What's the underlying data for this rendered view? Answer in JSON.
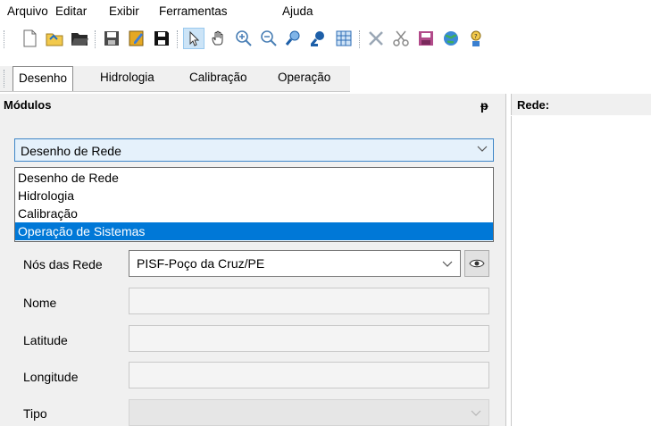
{
  "menu": {
    "items": [
      "Arquivo",
      "Editar",
      "Exibir",
      "Ferramentas",
      "Ajuda"
    ]
  },
  "toolbar": {
    "icons": [
      "new-file-icon",
      "open-icon",
      "open-folder-icon",
      "save-icon",
      "edit-icon",
      "save-as-icon",
      "pointer-icon",
      "pan-hand-icon",
      "zoom-in-icon",
      "zoom-out-icon",
      "zoom-extent-icon",
      "zoom-window-icon",
      "grid-icon",
      "tools-icon",
      "cut-icon",
      "export-icon",
      "globe-icon",
      "help-icon"
    ]
  },
  "tabs": {
    "items": [
      "Desenho",
      "Hidrologia",
      "Calibração",
      "Operação"
    ],
    "active": "Desenho"
  },
  "panel": {
    "title": "Módulos",
    "pin_glyph": "ᵽ"
  },
  "right": {
    "title": "Rede:"
  },
  "module_combo": {
    "value": "Desenho de Rede"
  },
  "dropdown": {
    "options": [
      "Desenho de Rede",
      "Hidrologia",
      "Calibração",
      "Operação de Sistemas"
    ],
    "highlighted": "Operação de Sistemas"
  },
  "form": {
    "nos_label": "Nós das Rede",
    "nos_value": "PISF-Poço da Cruz/PE",
    "nome_label": "Nome",
    "latitude_label": "Latitude",
    "longitude_label": "Longitude",
    "tipo_label": "Tipo"
  },
  "colors": {
    "highlight": "#0078d7",
    "combo_bg": "#e5f1fb",
    "combo_border": "#3f86c7"
  }
}
